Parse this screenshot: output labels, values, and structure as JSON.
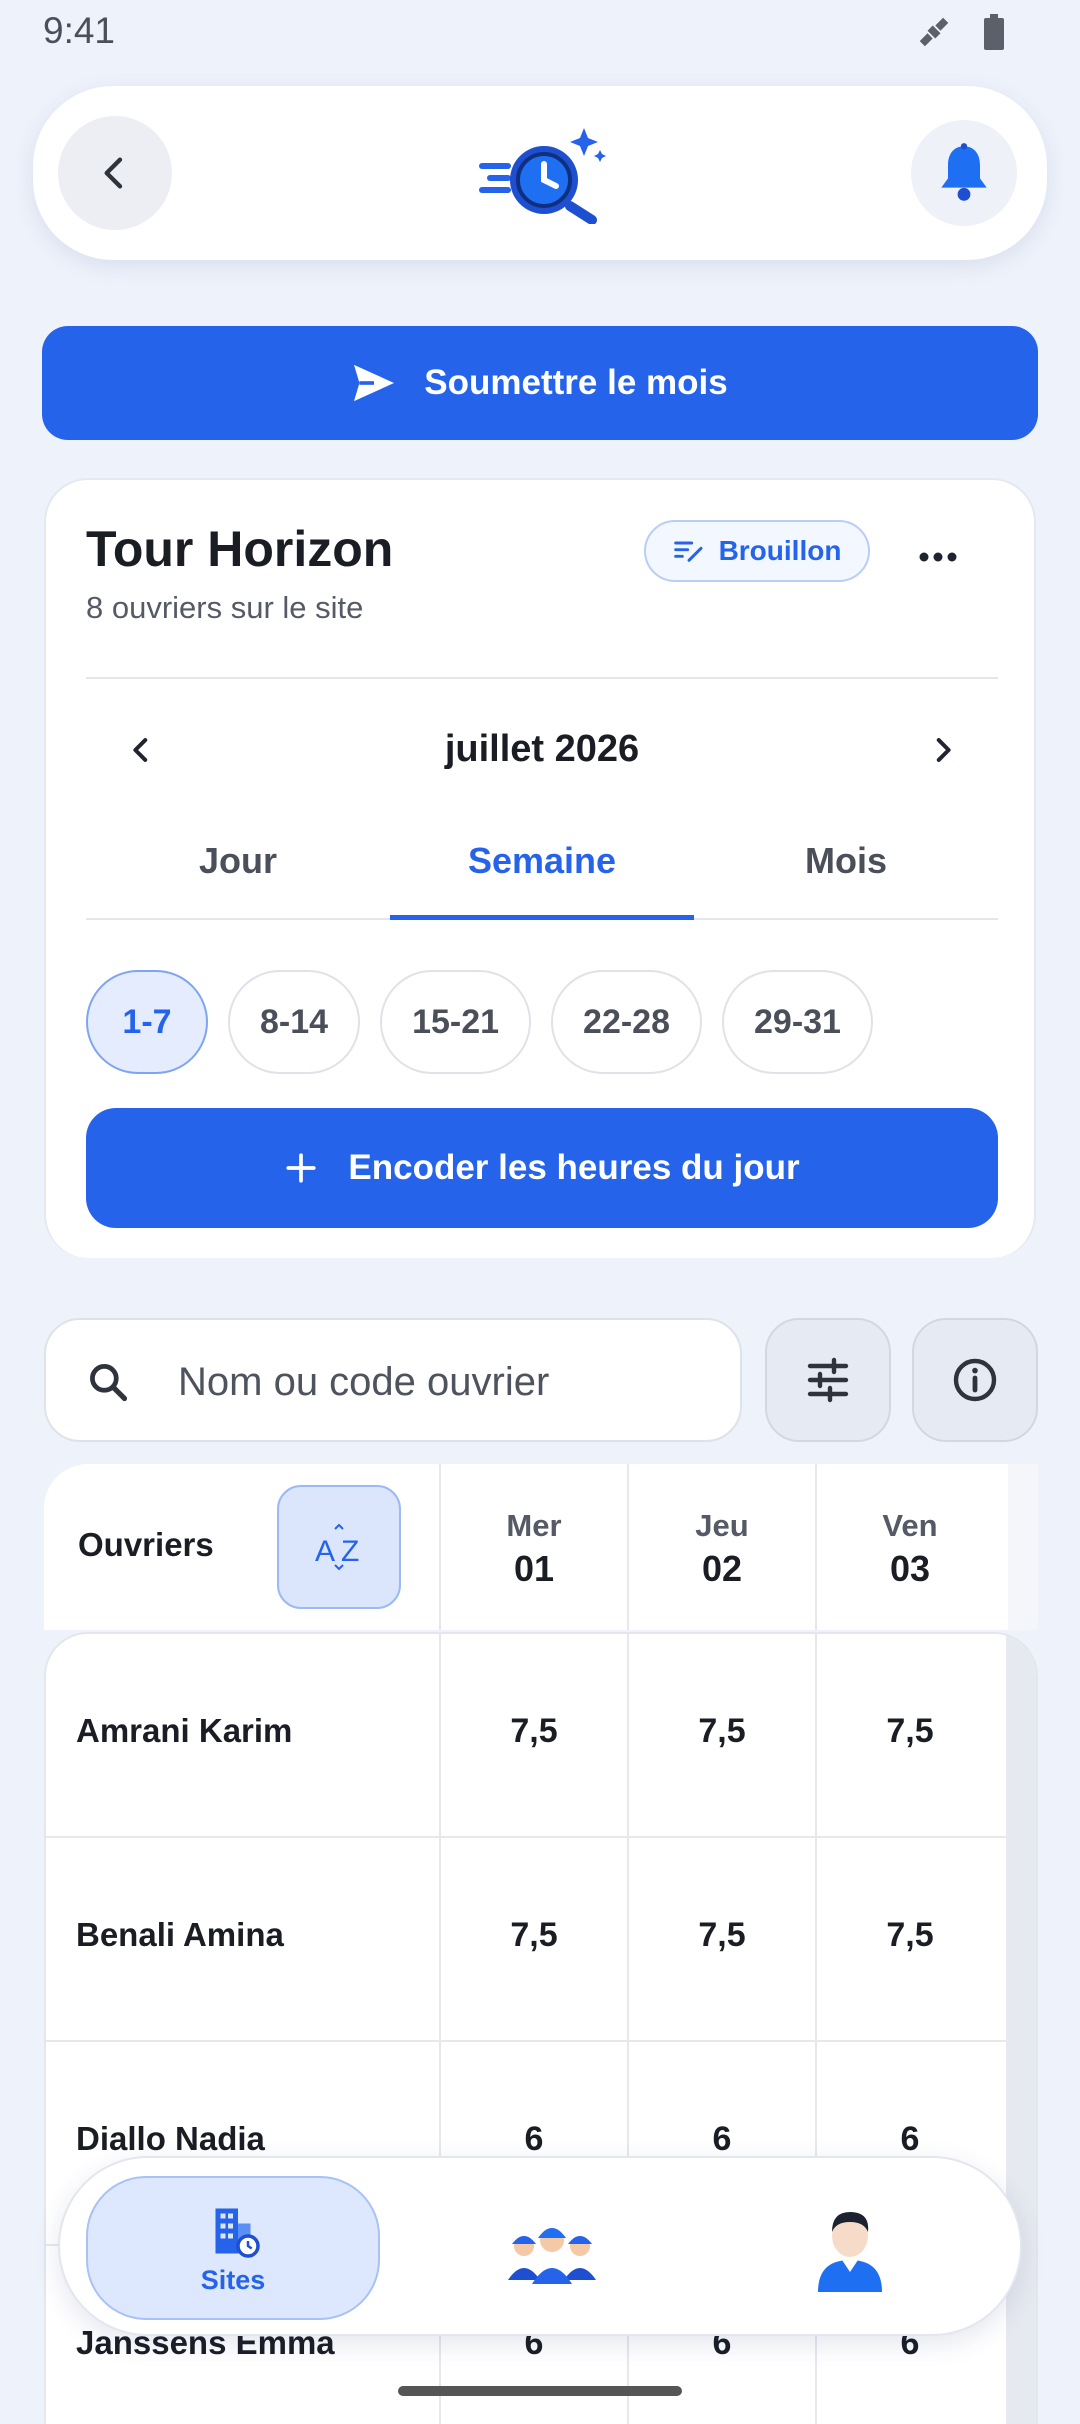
{
  "status_bar": {
    "time": "9:41"
  },
  "header": {
    "logo": "time-tracker-logo",
    "back_icon": "chevron-left-icon",
    "bell_icon": "bell-icon"
  },
  "submit": {
    "label": "Soumettre le mois",
    "icon": "send-icon"
  },
  "site": {
    "name": "Tour Horizon",
    "subtitle": "8 ouvriers sur le site",
    "badge": "Brouillon",
    "month": "juillet 2026",
    "tabs": [
      {
        "label": "Jour"
      },
      {
        "label": "Semaine"
      },
      {
        "label": "Mois"
      }
    ],
    "active_tab": "Semaine",
    "weeks": [
      {
        "label": "1-7"
      },
      {
        "label": "8-14"
      },
      {
        "label": "15-21"
      },
      {
        "label": "22-28"
      },
      {
        "label": "29-31"
      }
    ],
    "active_week": "1-7",
    "encode_label": "Encoder les heures du jour"
  },
  "search": {
    "placeholder": "Nom ou code ouvrier"
  },
  "table": {
    "header": "Ouvriers",
    "days": [
      {
        "name": "Mer",
        "num": "01"
      },
      {
        "name": "Jeu",
        "num": "02"
      },
      {
        "name": "Ven",
        "num": "03"
      }
    ],
    "rows": [
      {
        "name": "Amrani Karim",
        "values": [
          "7,5",
          "7,5",
          "7,5"
        ]
      },
      {
        "name": "Benali Amina",
        "values": [
          "7,5",
          "7,5",
          "7,5"
        ]
      },
      {
        "name": "Diallo Nadia",
        "values": [
          "6",
          "6",
          "6"
        ]
      },
      {
        "name": "Janssens Emma",
        "values": [
          "6",
          "6",
          "6"
        ]
      }
    ]
  },
  "bottom_nav": {
    "sites_label": "Sites"
  },
  "colors": {
    "primary": "#2563eb",
    "background": "#eef2fb"
  }
}
